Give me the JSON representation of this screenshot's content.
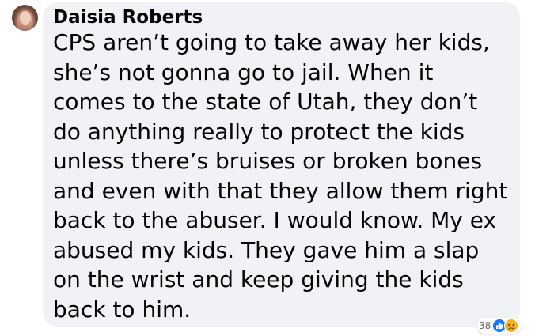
{
  "comment": {
    "author": "Daisia Roberts",
    "text_lines": [
      "CPS aren’t going to take away her kids,",
      "she’s not gonna go to jail. When it",
      "comes to the state of Utah, they don’t",
      "do anything really to protect the kids",
      "unless there’s bruises or broken bones",
      "and even with that they allow them right",
      "back to the abuser. I would know. My ex",
      "abused my kids. They gave him a slap",
      "on the wrist and keep giving the kids",
      "back to him."
    ],
    "avatar": "profile-photo",
    "reactions": {
      "count": "38",
      "icons": [
        "like-icon",
        "sad-icon"
      ]
    }
  },
  "colors": {
    "bubble_bg": "#f0f2f5",
    "text": "#050505",
    "muted": "#65676b",
    "like_blue": "#1877f2",
    "sad_yellow": "#f7b125"
  }
}
